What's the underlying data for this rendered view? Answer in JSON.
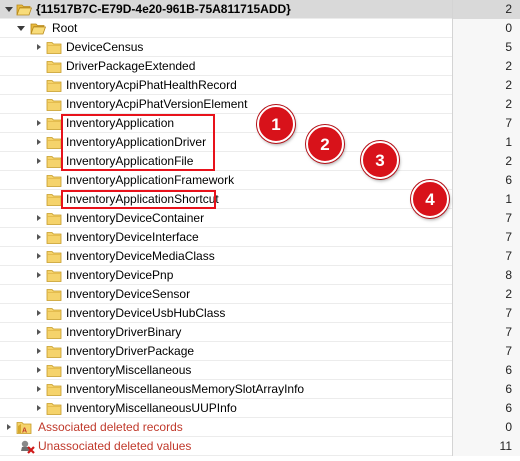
{
  "tree": {
    "header": {
      "name": "{11517B7C-E79D-4e20-961B-75A811715ADD}",
      "count": "2"
    },
    "root": {
      "name": "Root",
      "count": "0"
    },
    "items": [
      {
        "name": "DeviceCensus",
        "count": "5",
        "expandable": true
      },
      {
        "name": "DriverPackageExtended",
        "count": "2",
        "expandable": false
      },
      {
        "name": "InventoryAcpiPhatHealthRecord",
        "count": "2",
        "expandable": false
      },
      {
        "name": "InventoryAcpiPhatVersionElement",
        "count": "2",
        "expandable": false
      },
      {
        "name": "InventoryApplication",
        "count": "7",
        "expandable": true
      },
      {
        "name": "InventoryApplicationDriver",
        "count": "1",
        "expandable": true
      },
      {
        "name": "InventoryApplicationFile",
        "count": "2",
        "expandable": true
      },
      {
        "name": "InventoryApplicationFramework",
        "count": "6",
        "expandable": false
      },
      {
        "name": "InventoryApplicationShortcut",
        "count": "1",
        "expandable": false
      },
      {
        "name": "InventoryDeviceContainer",
        "count": "7",
        "expandable": true
      },
      {
        "name": "InventoryDeviceInterface",
        "count": "7",
        "expandable": true
      },
      {
        "name": "InventoryDeviceMediaClass",
        "count": "7",
        "expandable": true
      },
      {
        "name": "InventoryDevicePnp",
        "count": "8",
        "expandable": true
      },
      {
        "name": "InventoryDeviceSensor",
        "count": "2",
        "expandable": false
      },
      {
        "name": "InventoryDeviceUsbHubClass",
        "count": "7",
        "expandable": true
      },
      {
        "name": "InventoryDriverBinary",
        "count": "7",
        "expandable": true
      },
      {
        "name": "InventoryDriverPackage",
        "count": "7",
        "expandable": true
      },
      {
        "name": "InventoryMiscellaneous",
        "count": "6",
        "expandable": true
      },
      {
        "name": "InventoryMiscellaneousMemorySlotArrayInfo",
        "count": "6",
        "expandable": true
      },
      {
        "name": "InventoryMiscellaneousUUPInfo",
        "count": "6",
        "expandable": true
      }
    ],
    "associated_deleted": {
      "name": "Associated deleted records",
      "count": "0"
    },
    "unassociated_deleted": {
      "name": "Unassociated deleted values",
      "count": "11"
    }
  },
  "callouts": [
    "1",
    "2",
    "3",
    "4"
  ],
  "colors": {
    "highlight": "#e8121b",
    "badge": "#d8121a",
    "folder": "#f5d36b",
    "deleted_text": "#c0392b"
  },
  "icons": {
    "folder": "folder-icon",
    "expand": "expand-arrow-icon",
    "collapse": "collapse-arrow-icon",
    "deleted": "deleted-values-icon"
  }
}
